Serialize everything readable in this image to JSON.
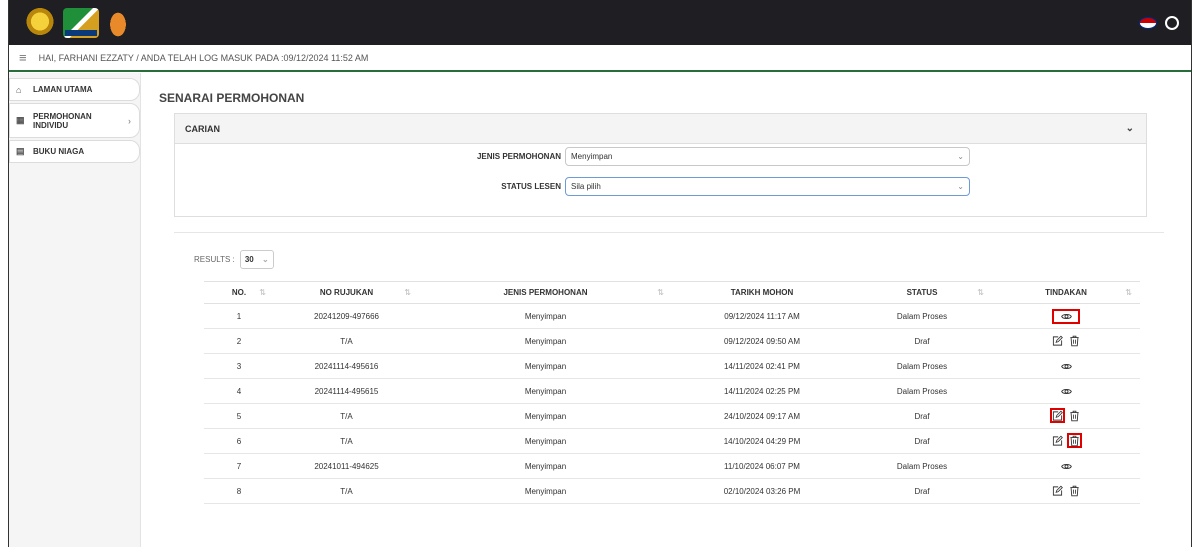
{
  "header": {
    "logos": [
      "crest-logo",
      "organization-logo",
      "tiger-logo"
    ]
  },
  "breadcrumb": {
    "text": "HAI, FARHANI EZZATY / ANDA TELAH LOG MASUK PADA :09/12/2024 11:52 AM"
  },
  "sidebar": {
    "items": [
      {
        "label": "LAMAN UTAMA",
        "icon": "home-icon"
      },
      {
        "label": "PERMOHONAN INDIVIDU",
        "icon": "grid-icon"
      },
      {
        "label": "BUKU NIAGA",
        "icon": "document-icon"
      }
    ]
  },
  "main": {
    "title": "SENARAI PERMOHONAN",
    "search": {
      "title": "CARIAN",
      "jenis_label": "JENIS PERMOHONAN",
      "jenis_value": "Menyimpan",
      "status_label": "STATUS LESEN",
      "status_value": "Sila pilih"
    },
    "results_label": "RESULTS :",
    "results_value": "30"
  },
  "table": {
    "headers": [
      "NO.",
      "NO RUJUKAN",
      "JENIS PERMOHONAN",
      "TARIKH MOHON",
      "STATUS",
      "TINDAKAN"
    ],
    "rows": [
      {
        "no": "1",
        "ruj": "20241209-497666",
        "jenis": "Menyimpan",
        "tarikh": "09/12/2024 11:17 AM",
        "status": "Dalam Proses",
        "actions": "view"
      },
      {
        "no": "2",
        "ruj": "T/A",
        "jenis": "Menyimpan",
        "tarikh": "09/12/2024 09:50 AM",
        "status": "Draf",
        "actions": "edit-delete"
      },
      {
        "no": "3",
        "ruj": "20241114-495616",
        "jenis": "Menyimpan",
        "tarikh": "14/11/2024 02:41 PM",
        "status": "Dalam Proses",
        "actions": "view"
      },
      {
        "no": "4",
        "ruj": "20241114-495615",
        "jenis": "Menyimpan",
        "tarikh": "14/11/2024 02:25 PM",
        "status": "Dalam Proses",
        "actions": "view"
      },
      {
        "no": "5",
        "ruj": "T/A",
        "jenis": "Menyimpan",
        "tarikh": "24/10/2024 09:17 AM",
        "status": "Draf",
        "actions": "edit-delete"
      },
      {
        "no": "6",
        "ruj": "T/A",
        "jenis": "Menyimpan",
        "tarikh": "14/10/2024 04:29 PM",
        "status": "Draf",
        "actions": "edit-delete"
      },
      {
        "no": "7",
        "ruj": "20241011-494625",
        "jenis": "Menyimpan",
        "tarikh": "11/10/2024 06:07 PM",
        "status": "Dalam Proses",
        "actions": "view"
      },
      {
        "no": "8",
        "ruj": "T/A",
        "jenis": "Menyimpan",
        "tarikh": "02/10/2024 03:26 PM",
        "status": "Draf",
        "actions": "edit-delete"
      }
    ]
  },
  "colors": {
    "topbar": "#1f1f23",
    "accent_line": "#2a6d3c",
    "highlight": "#e00000"
  }
}
